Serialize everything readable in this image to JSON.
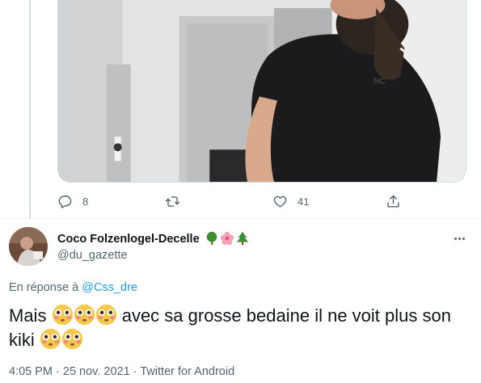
{
  "tweet_actions": {
    "reply_count": "8",
    "retweet_count": "",
    "like_count": "41"
  },
  "reply_tweet": {
    "display_name": "Coco Folzenlogel-Decelle",
    "name_emojis": [
      "tree-emoji",
      "hibiscus-emoji",
      "evergreen-tree-emoji"
    ],
    "handle": "@du_gazette",
    "reply_prefix": "En réponse à",
    "reply_to_handle": "@Css_dre",
    "text_part1": "Mais",
    "text_part2": "avec sa grosse bedaine il ne voit plus son kiki",
    "emoji_name": "flushed-face-emoji",
    "timestamp": "4:05 PM · 25 nov. 2021 · Twitter for Android"
  },
  "colors": {
    "text_primary": "#0f1419",
    "text_secondary": "#536471",
    "link": "#1d9bf0",
    "border": "#cfd9de"
  }
}
